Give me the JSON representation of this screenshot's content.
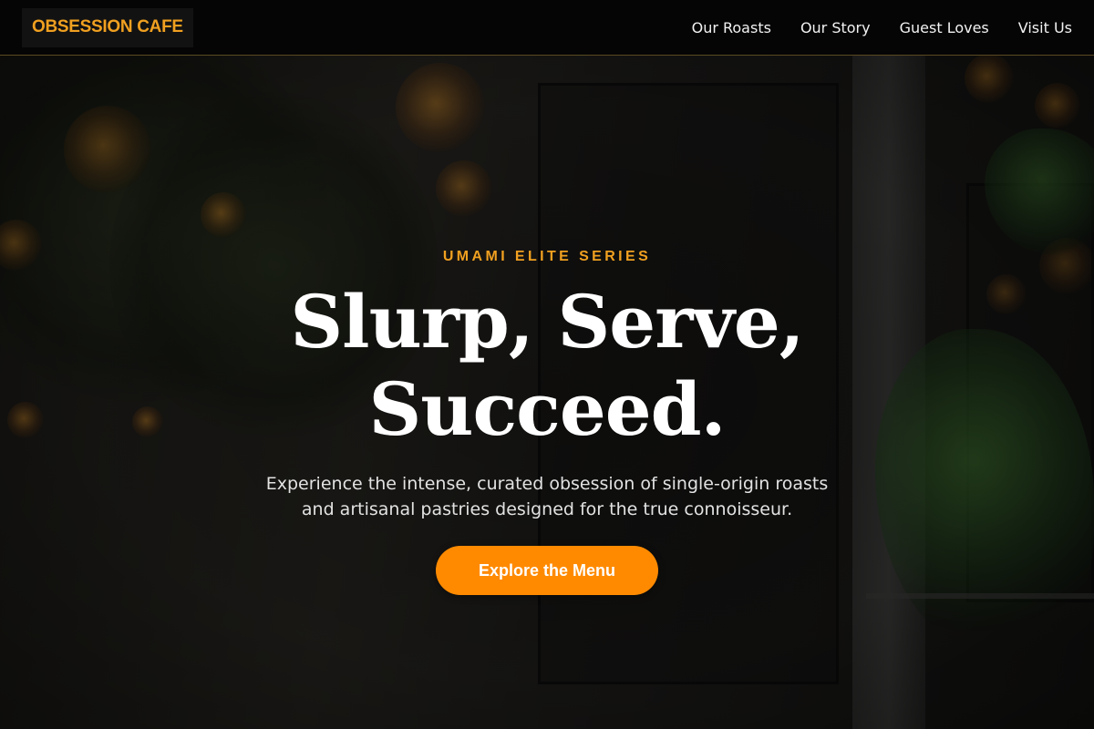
{
  "header": {
    "brand": "OBSESSION CAFE",
    "nav": [
      {
        "label": "Our Roasts"
      },
      {
        "label": "Our Story"
      },
      {
        "label": "Guest Loves"
      },
      {
        "label": "Visit Us"
      }
    ]
  },
  "hero": {
    "eyebrow": "UMAMI ELITE SERIES",
    "headline_line1": "Slurp, Serve,",
    "headline_line2": "Succeed.",
    "subtitle_line1": "Experience the intense, curated obsession of single-origin roasts",
    "subtitle_line2": "and artisanal pastries designed for the true connoisseur.",
    "cta_label": "Explore the Menu"
  },
  "colors": {
    "accent": "#f0a020",
    "button": "#ff8a00",
    "header_bg": "#050505"
  }
}
